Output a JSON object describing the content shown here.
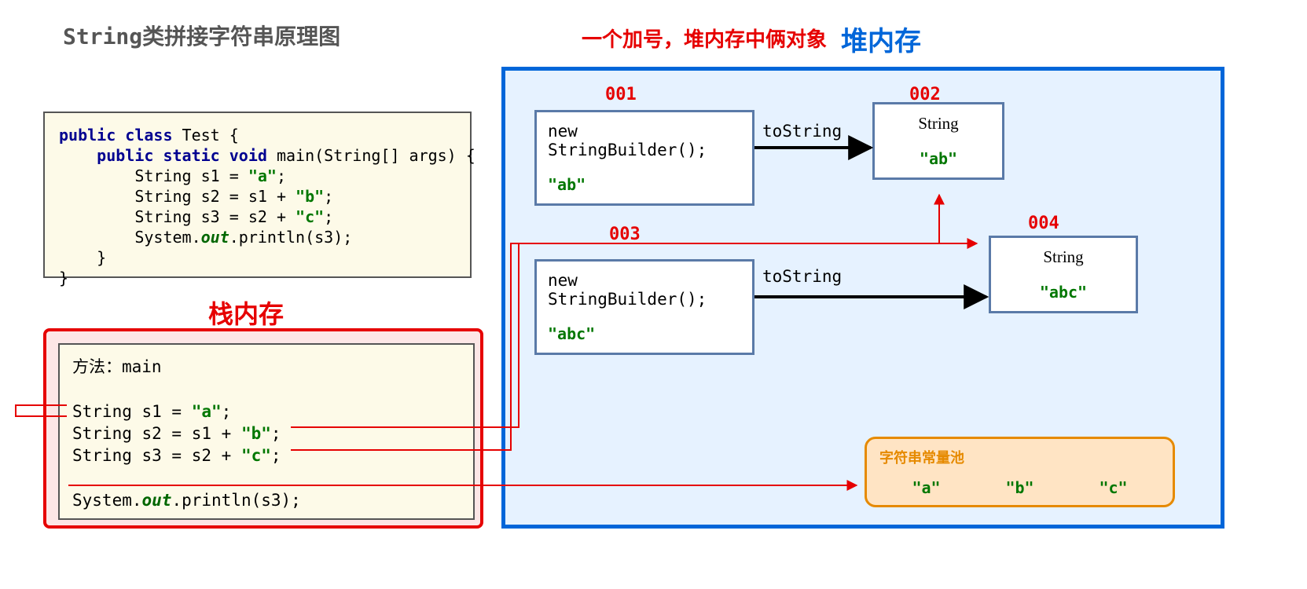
{
  "titles": {
    "main": "String类拼接字符串原理图",
    "red": "一个加号，堆内存中俩对象",
    "heap": "堆内存",
    "stack": "栈内存"
  },
  "code": {
    "l1_a": "public class",
    "l1_b": " Test {",
    "l2_a": "    public static void",
    "l2_b": " main(String[] args) {",
    "l3_a": "        String s1 = ",
    "l3_b": "\"a\"",
    "l3_c": ";",
    "l4_a": "        String s2 = s1 + ",
    "l4_b": "\"b\"",
    "l4_c": ";",
    "l5_a": "        String s3 = s2 + ",
    "l5_b": "\"c\"",
    "l5_c": ";",
    "l6_a": "        System.",
    "l6_b": "out",
    "l6_c": ".println(s3);",
    "l7": "    }",
    "l8": "}"
  },
  "stack": {
    "l1": "方法：main",
    "l2": "",
    "l3_a": "String s1 = ",
    "l3_b": "\"a\"",
    "l3_c": ";",
    "l4_a": "String s2 = s1 + ",
    "l4_b": "\"b\"",
    "l4_c": ";",
    "l5_a": "String s3 = s2 + ",
    "l5_b": "\"c\"",
    "l5_c": ";",
    "l6": "",
    "l7_a": "System.",
    "l7_b": "out",
    "l7_c": ".println(s3);"
  },
  "heap": {
    "addr1": "001",
    "addr2": "002",
    "addr3": "003",
    "addr4": "004",
    "box1_line1": "new StringBuilder();",
    "box1_line2": "\"ab\"",
    "box2_line1": "String",
    "box2_line2": "\"ab\"",
    "box3_line1": "new StringBuilder();",
    "box3_line2": "\"abc\"",
    "box4_line1": "String",
    "box4_line2": "\"abc\"",
    "arrow1_label": "toString",
    "arrow2_label": "toString"
  },
  "pool": {
    "title": "字符串常量池",
    "items": [
      "\"a\"",
      "\"b\"",
      "\"c\""
    ]
  }
}
